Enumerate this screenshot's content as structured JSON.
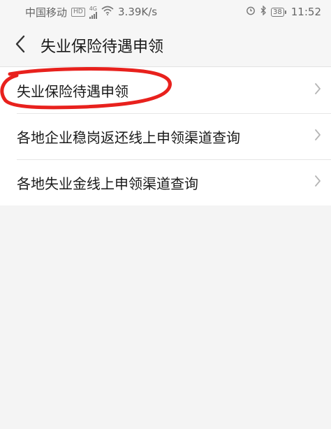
{
  "status_bar": {
    "carrier": "中国移动",
    "hd_badge": "HD",
    "network": "4G",
    "speed": "3.39K/s",
    "battery": "38",
    "time": "11:52"
  },
  "nav": {
    "title": "失业保险待遇申领",
    "back_icon": "chevron-left-icon"
  },
  "list": {
    "items": [
      {
        "label": "失业保险待遇申领",
        "icon": "chevron-right-icon"
      },
      {
        "label": "各地企业稳岗返还线上申领渠道查询",
        "icon": "chevron-right-icon"
      },
      {
        "label": "各地失业金线上申领渠道查询",
        "icon": "chevron-right-icon"
      }
    ]
  },
  "colors": {
    "background": "#f4f4f4",
    "list_background": "#ffffff",
    "annotation_red": "#e8211d",
    "chevron": "#b5b5b5"
  }
}
